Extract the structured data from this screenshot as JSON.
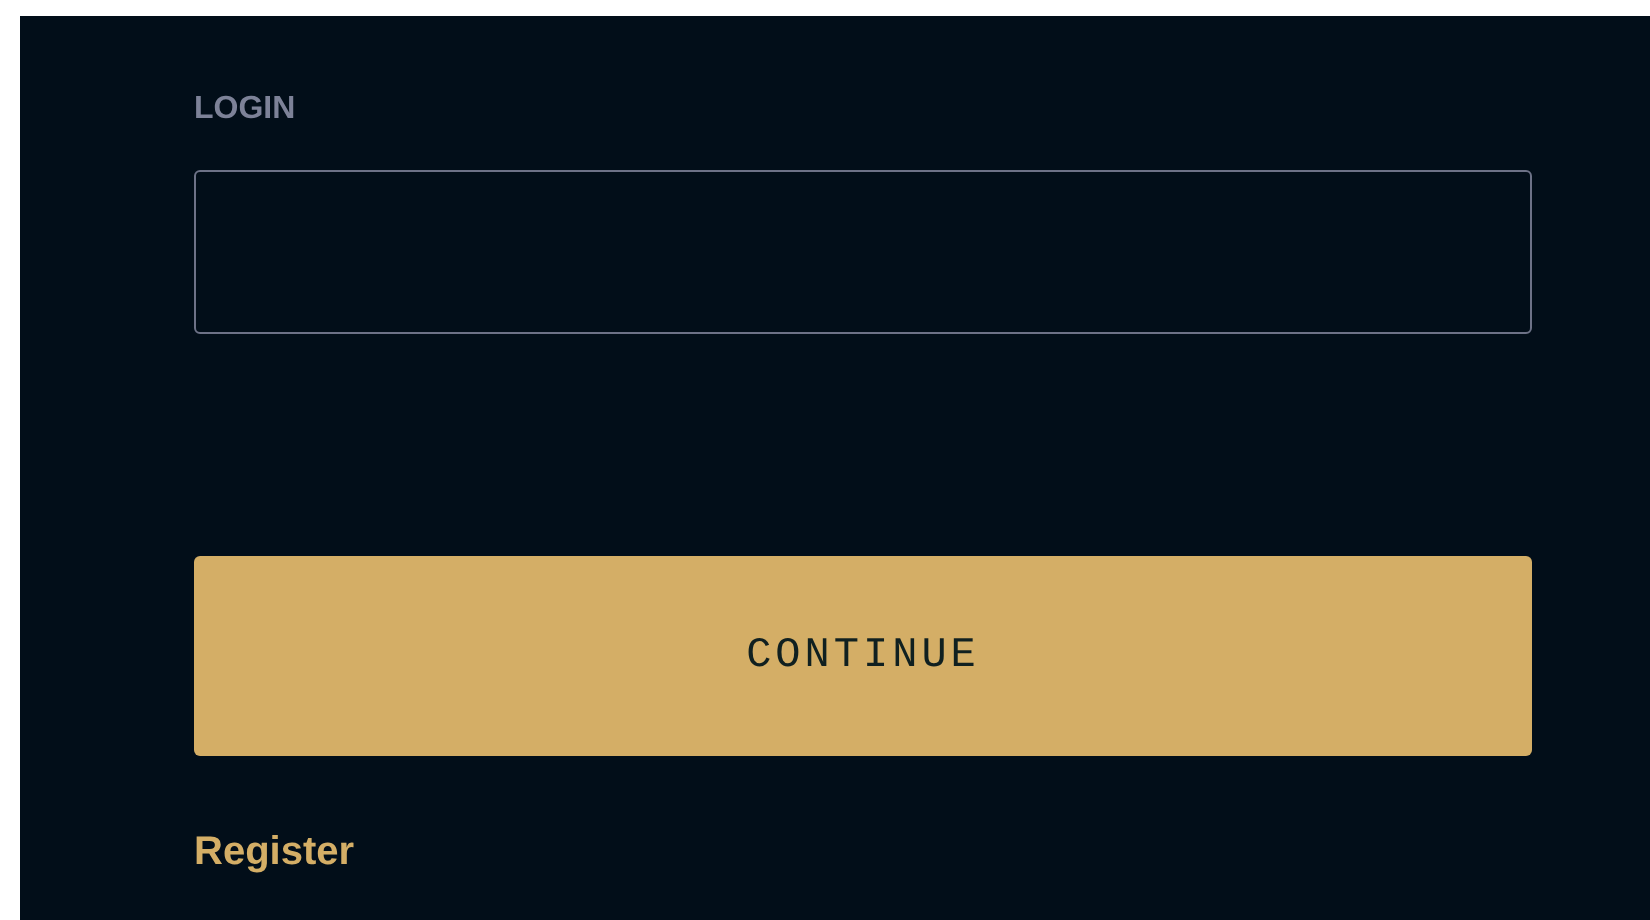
{
  "login_field": {
    "label": "LOGIN"
  },
  "continue_button": {
    "label": "CONTINUE"
  },
  "register_link": {
    "label": "Register"
  }
}
